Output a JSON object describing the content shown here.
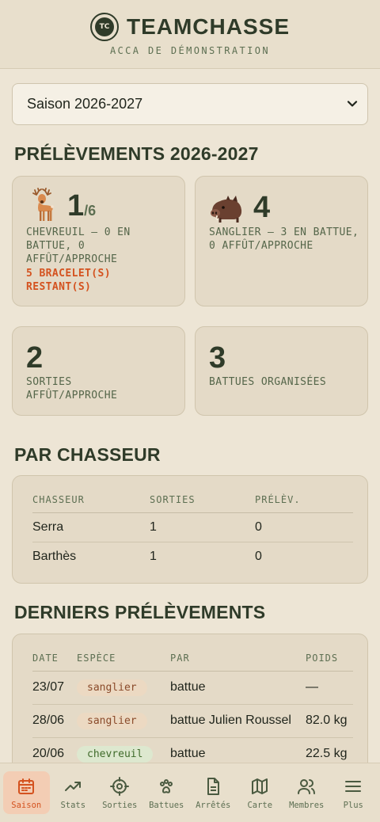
{
  "header": {
    "logo_text": "TC",
    "app_name": "TEAMCHASSE",
    "subtitle": "ACCA DE DÉMONSTRATION"
  },
  "season_select": {
    "selected": "Saison 2026-2027"
  },
  "prelevements": {
    "title": "PRÉLÈVEMENTS 2026-2027",
    "cards": [
      {
        "icon": "deer-icon",
        "value": "1",
        "quota": "/6",
        "desc": "CHEVREUIL — 0 EN BATTUE, 0 AFFÛT/APPROCHE",
        "warning": "5 BRACELET(S) RESTANT(S)"
      },
      {
        "icon": "boar-icon",
        "value": "4",
        "desc": "SANGLIER — 3 EN BATTUE, 0 AFFÛT/APPROCHE"
      }
    ],
    "summary": [
      {
        "value": "2",
        "desc": "SORTIES AFFÛT/APPROCHE"
      },
      {
        "value": "3",
        "desc": "BATTUES ORGANISÉES"
      }
    ]
  },
  "par_chasseur": {
    "title": "PAR CHASSEUR",
    "columns": [
      "CHASSEUR",
      "SORTIES",
      "PRÉLÈV."
    ],
    "rows": [
      [
        "Serra",
        "1",
        "0"
      ],
      [
        "Barthès",
        "1",
        "0"
      ]
    ]
  },
  "derniers": {
    "title": "DERNIERS PRÉLÈVEMENTS",
    "columns": [
      "DATE",
      "ESPÈCE",
      "PAR",
      "POIDS"
    ],
    "rows": [
      {
        "date": "23/07",
        "species": "sanglier",
        "par": "battue",
        "poids": "—"
      },
      {
        "date": "28/06",
        "species": "sanglier",
        "par": "battue Julien Roussel",
        "poids": "82.0 kg"
      },
      {
        "date": "20/06",
        "species": "chevreuil",
        "par": "battue",
        "poids": "22.5 kg"
      }
    ]
  },
  "colors": {
    "accent": "#d4521f",
    "primary": "#2f3b29",
    "sanglier_pill": "#ecd9c2",
    "chevreuil_pill": "#dde8cf"
  },
  "nav": [
    {
      "label": "Saison",
      "icon": "calendar-icon",
      "active": true
    },
    {
      "label": "Stats",
      "icon": "trend-icon"
    },
    {
      "label": "Sorties",
      "icon": "crosshair-icon"
    },
    {
      "label": "Battues",
      "icon": "paw-icon"
    },
    {
      "label": "Arrêtés",
      "icon": "document-icon"
    },
    {
      "label": "Carte",
      "icon": "map-icon"
    },
    {
      "label": "Membres",
      "icon": "users-icon"
    },
    {
      "label": "Plus",
      "icon": "menu-icon"
    }
  ]
}
